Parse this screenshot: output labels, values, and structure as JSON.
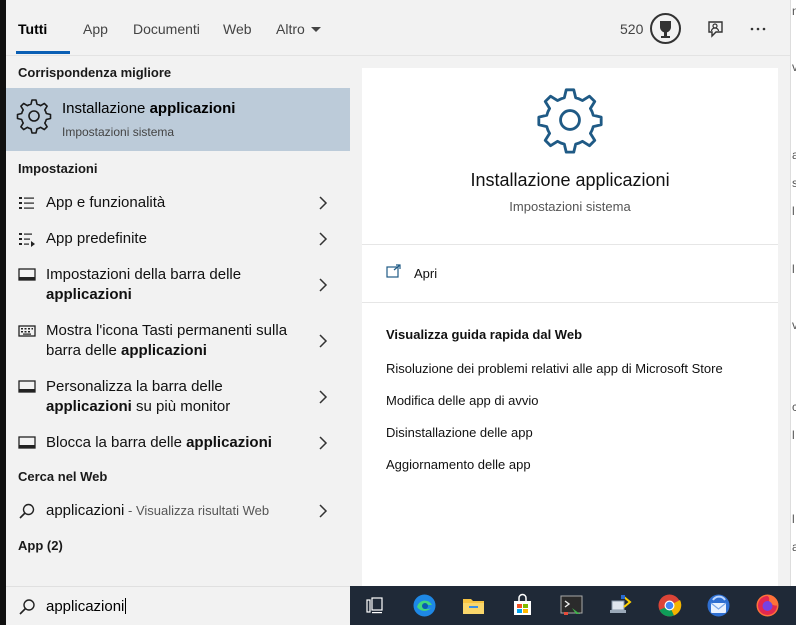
{
  "tabs": {
    "all": "Tutti",
    "apps": "App",
    "documents": "Documenti",
    "web": "Web",
    "more": "Altro"
  },
  "points": "520",
  "left": {
    "best_match_header": "Corrispondenza migliore",
    "best_match": {
      "title_plain": "Installazione ",
      "title_bold": "applicazioni",
      "subtitle": "Impostazioni sistema"
    },
    "settings_header": "Impostazioni",
    "settings_items": [
      {
        "pre": "App e funzionalità",
        "bold": "",
        "post": ""
      },
      {
        "pre": "App predefinite",
        "bold": "",
        "post": ""
      },
      {
        "pre": "Impostazioni della barra delle ",
        "bold": "applicazioni",
        "post": ""
      },
      {
        "pre": "Mostra l'icona Tasti permanenti sulla barra delle ",
        "bold": "applicazioni",
        "post": ""
      },
      {
        "pre": "Personalizza la barra delle ",
        "bold": "applicazioni",
        "post": " su più monitor"
      },
      {
        "pre": "Blocca la barra delle ",
        "bold": "applicazioni",
        "post": ""
      }
    ],
    "web_header": "Cerca nel Web",
    "web_result": {
      "query": "applicazioni",
      "suffix": " - Visualizza risultati Web"
    },
    "apps_header": "App (2)"
  },
  "search": {
    "value": "applicazioni"
  },
  "detail": {
    "title": "Installazione applicazioni",
    "subtitle": "Impostazioni sistema",
    "open_label": "Apri",
    "web_header": "Visualizza guida rapida dal Web",
    "web_links": [
      "Risoluzione dei problemi relativi alle app di Microsoft Store",
      "Modifica delle app di avvio",
      "Disinstallazione delle app",
      "Aggiornamento delle app"
    ]
  },
  "taskbar_icons": [
    "task-view-icon",
    "edge-icon",
    "file-explorer-icon",
    "store-icon",
    "terminal-app-icon",
    "network-app-icon",
    "chrome-icon",
    "thunderbird-icon",
    "firefox-icon"
  ],
  "colors": {
    "accent": "#0a5fb4",
    "selected_bg": "#bccbd9",
    "gear_blue": "#1f5a85",
    "taskbar": "#1f2937"
  }
}
